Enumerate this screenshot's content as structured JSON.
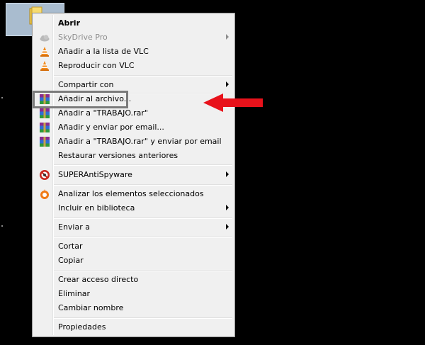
{
  "colors": {
    "accent_arrow": "#e8121b",
    "highlight_frame": "#7b7b7b",
    "menu_bg": "#f0f0f0"
  },
  "desktop": {
    "folder_icon": "folder-icon"
  },
  "menu": {
    "items": [
      {
        "label": "Abrir",
        "bold": true,
        "icon": "",
        "submenu": false,
        "disabled": false
      },
      {
        "label": "SkyDrive Pro",
        "icon": "cloud-icon",
        "submenu": true,
        "disabled": true
      },
      {
        "label": "Añadir a la lista de VLC",
        "icon": "vlc-cone-icon",
        "submenu": false,
        "disabled": false
      },
      {
        "label": "Reproducir con VLC",
        "icon": "vlc-cone-icon",
        "submenu": false,
        "disabled": false
      },
      {
        "label": "Compartir con",
        "icon": "",
        "submenu": true,
        "disabled": false
      },
      {
        "label": "Añadir al archivo...",
        "icon": "winrar-icon",
        "submenu": false,
        "disabled": false
      },
      {
        "label": "Añadir a \"TRABAJO.rar\"",
        "icon": "winrar-icon",
        "submenu": false,
        "disabled": false
      },
      {
        "label": "Añadir y enviar por email...",
        "icon": "winrar-icon",
        "submenu": false,
        "disabled": false
      },
      {
        "label": "Añadir a \"TRABAJO.rar\" y enviar por email",
        "icon": "winrar-icon",
        "submenu": false,
        "disabled": false
      },
      {
        "label": "Restaurar versiones anteriores",
        "icon": "",
        "submenu": false,
        "disabled": false
      },
      {
        "label": "SUPERAntiSpyware",
        "icon": "superantispyware-icon",
        "submenu": true,
        "disabled": false
      },
      {
        "label": "Analizar los elementos seleccionados",
        "icon": "avast-icon",
        "submenu": false,
        "disabled": false
      },
      {
        "label": "Incluir en biblioteca",
        "icon": "",
        "submenu": true,
        "disabled": false
      },
      {
        "label": "Enviar a",
        "icon": "",
        "submenu": true,
        "disabled": false
      },
      {
        "label": "Cortar",
        "icon": "",
        "submenu": false,
        "disabled": false
      },
      {
        "label": "Copiar",
        "icon": "",
        "submenu": false,
        "disabled": false
      },
      {
        "label": "Crear acceso directo",
        "icon": "",
        "submenu": false,
        "disabled": false
      },
      {
        "label": "Eliminar",
        "icon": "",
        "submenu": false,
        "disabled": false
      },
      {
        "label": "Cambiar nombre",
        "icon": "",
        "submenu": false,
        "disabled": false
      },
      {
        "label": "Propiedades",
        "icon": "",
        "submenu": false,
        "disabled": false
      }
    ]
  }
}
